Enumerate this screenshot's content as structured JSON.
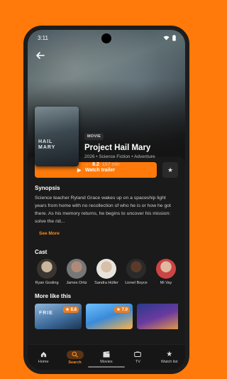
{
  "status_bar": {
    "time": "3:11"
  },
  "movie": {
    "type_chip": "MOVIE",
    "title": "Project Hail Mary",
    "poster_text": "HAIL MARY",
    "meta": "2026 • Science Fiction • Adventure",
    "rating": "8.2",
    "runtime": "157 min"
  },
  "actions": {
    "trailer_label": "Watch trailer"
  },
  "synopsis": {
    "heading": "Synopsis",
    "text": "Science teacher Ryland Grace wakes up on a spaceship light years from home with no recollection of who he is or how he got there. As his memory returns, he begins to uncover his mission: solve the rid...",
    "see_more": "See More"
  },
  "cast": {
    "heading": "Cast",
    "members": [
      {
        "name": "Ryan Gosling"
      },
      {
        "name": "James Ortiz"
      },
      {
        "name": "Sandra Hüller"
      },
      {
        "name": "Lionel Boyce"
      },
      {
        "name": "Mi Vay"
      }
    ]
  },
  "more_like_this": {
    "heading": "More like this",
    "items": [
      {
        "label": "FRIE",
        "rating": "8.8"
      },
      {
        "label": "",
        "rating": "7.0"
      },
      {
        "label": "",
        "rating": ""
      }
    ]
  },
  "nav": {
    "items": [
      {
        "label": "Home",
        "icon": "home-icon"
      },
      {
        "label": "Search",
        "icon": "search-icon"
      },
      {
        "label": "Movies",
        "icon": "clapperboard-icon"
      },
      {
        "label": "TV",
        "icon": "tv-icon"
      },
      {
        "label": "Watch list",
        "icon": "star-icon"
      }
    ],
    "active": "Search"
  },
  "colors": {
    "accent": "#ff7a0a",
    "background": "#141414"
  }
}
